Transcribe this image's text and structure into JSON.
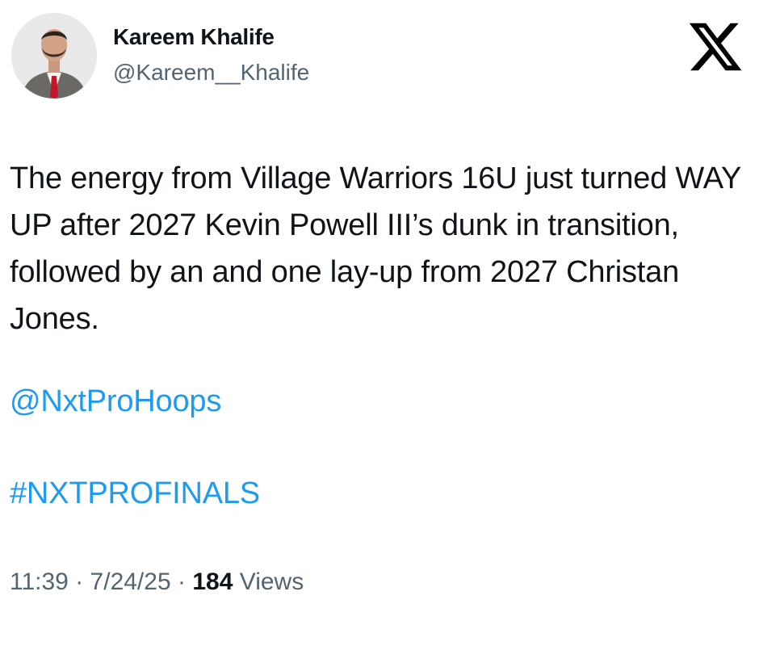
{
  "author": {
    "display_name": "Kareem Khalife",
    "handle": "@Kareem__Khalife"
  },
  "platform_icon": "x-logo-icon",
  "tweet": {
    "text": "The energy from Village Warriors 16U just turned WAY UP after 2027 Kevin Powell III’s dunk in transition, followed by an and one lay-up from 2027 Christan Jones.",
    "mention": "@NxtProHoops",
    "hashtag": "#NXTPROFINALS"
  },
  "meta": {
    "time": "11:39",
    "separator": "·",
    "date": "7/24/25",
    "views_count": "184",
    "views_label": "Views"
  },
  "colors": {
    "link": "#1d9bf0",
    "secondary_text": "#536471",
    "primary_text": "#0f1419"
  }
}
